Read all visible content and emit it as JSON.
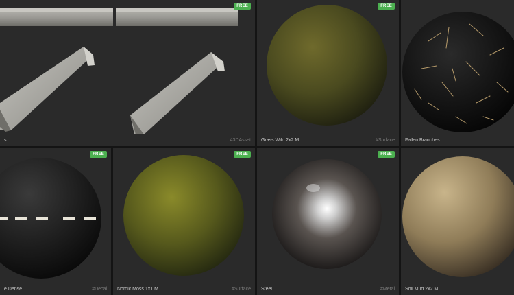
{
  "cards": [
    {
      "name": "s",
      "tag": "#3DAsset",
      "badge": "FREE",
      "icon": "concrete-curb-render"
    },
    {
      "name": "Grass Wild 2x2 M",
      "tag": "#Surface",
      "badge": "FREE",
      "icon": "grass-sphere"
    },
    {
      "name": "Fallen Branches",
      "tag": "",
      "badge": "",
      "icon": "branches-sphere"
    },
    {
      "name": "e Dense",
      "tag": "#Decal",
      "badge": "FREE",
      "icon": "dashed-line-sphere"
    },
    {
      "name": "Nordic Moss 1x1 M",
      "tag": "#Surface",
      "badge": "FREE",
      "icon": "moss-sphere"
    },
    {
      "name": "Steel",
      "tag": "#Metal",
      "badge": "FREE",
      "icon": "steel-sphere"
    },
    {
      "name": "Soil Mud 2x2 M",
      "tag": "",
      "badge": "",
      "icon": "soil-sphere"
    }
  ],
  "colors": {
    "background": "#141414",
    "card": "#2a2a2a",
    "free_badge": "#4cb050",
    "name_text": "#c9c9c9",
    "tag_text": "#7b7b7b"
  }
}
